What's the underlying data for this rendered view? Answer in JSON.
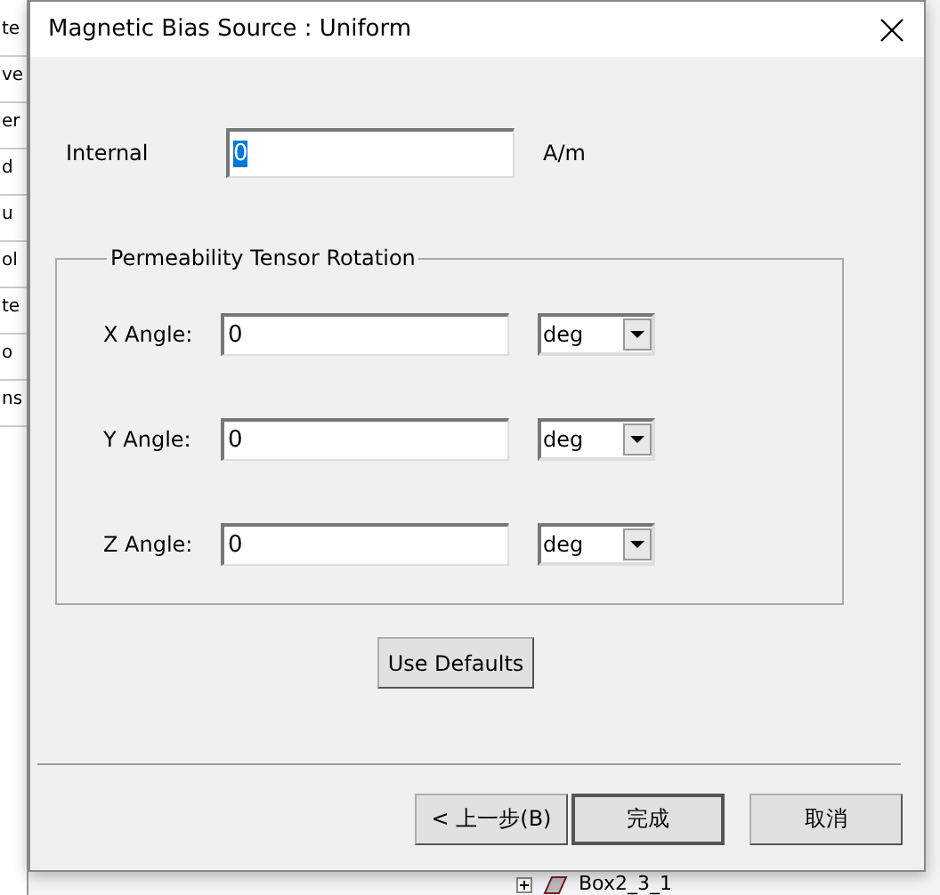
{
  "background": {
    "list_items": [
      "te",
      "ve",
      "er",
      "d",
      "u",
      "ol",
      "te",
      "o",
      "ns"
    ],
    "tree_item": "Box2_3_1"
  },
  "dialog": {
    "title": "Magnetic Bias Source : Uniform",
    "internal": {
      "label": "Internal",
      "value": "0",
      "text_selected": true,
      "unit": "A/m"
    },
    "group": {
      "title": "Permeability Tensor Rotation",
      "rows": [
        {
          "label": "X Angle:",
          "value": "0",
          "unit": "deg"
        },
        {
          "label": "Y Angle:",
          "value": "0",
          "unit": "deg"
        },
        {
          "label": "Z Angle:",
          "value": "0",
          "unit": "deg"
        }
      ]
    },
    "defaults_button": "Use Defaults",
    "buttons": [
      {
        "label": "< 上一步(B)",
        "default": false
      },
      {
        "label": "完成",
        "default": true
      },
      {
        "label": "取消",
        "default": false
      }
    ]
  }
}
